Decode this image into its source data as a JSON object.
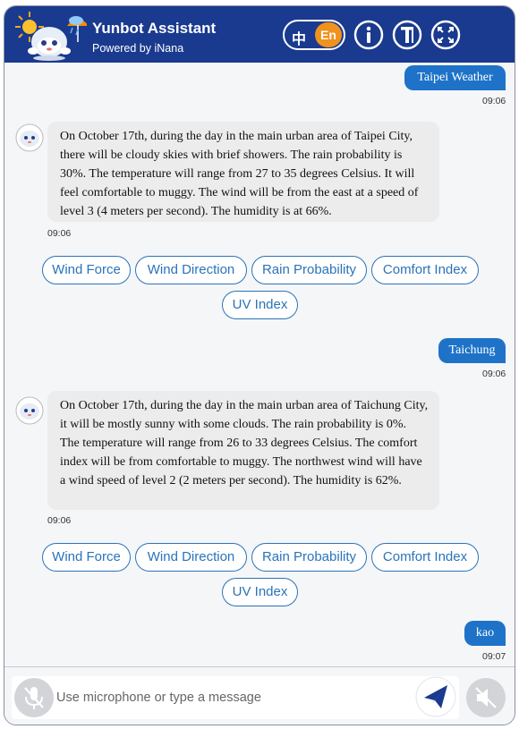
{
  "header": {
    "title": "Yunbot Assistant",
    "subtitle": "Powered by iNana",
    "lang_zh": "中",
    "lang_en": "En",
    "info_icon": "info-icon",
    "text_size_icon": "text-size-icon",
    "fullscreen_icon": "fullscreen-icon"
  },
  "messages": [
    {
      "type": "user",
      "text": "Taipei Weather",
      "time": "09:06"
    },
    {
      "type": "bot",
      "text": "On October 17th, during the day in the main urban area of Taipei City, there will be cloudy skies with brief showers. The rain probability is 30%. The temperature will range from 27 to 35 degrees Celsius. It will feel comfortable to muggy. The wind will be from the east at a speed of level 3 (4 meters per second). The humidity is at 66%.",
      "time": "09:06",
      "chips": [
        "Wind Force",
        "Wind Direction",
        "Rain Probability",
        "Comfort Index",
        "UV Index"
      ]
    },
    {
      "type": "user",
      "text": "Taichung",
      "time": "09:06"
    },
    {
      "type": "bot",
      "text": "On October 17th, during the day in the main urban area of Taichung City, it will be mostly sunny with some clouds. The rain probability is 0%. The temperature will range from 26 to 33 degrees Celsius. The comfort index will be from comfortable to muggy. The northwest wind will have a wind speed of level 2 (2 meters per second). The humidity is 62%.",
      "time": "09:06",
      "chips": [
        "Wind Force",
        "Wind Direction",
        "Rain Probability",
        "Comfort Index",
        "UV Index"
      ]
    },
    {
      "type": "user",
      "text": "kao",
      "time": "09:07"
    }
  ],
  "footer": {
    "input_placeholder": "Use microphone or type a message",
    "input_value": "",
    "mic_icon": "microphone-muted-icon",
    "send_icon": "send-icon",
    "sound_icon": "sound-muted-icon"
  },
  "colors": {
    "header_bg": "#1a3a8f",
    "lang_active": "#f0921d",
    "user_bubble": "#1e73c8",
    "chip_border": "#2b73b8",
    "bot_bubble": "#ececec"
  }
}
